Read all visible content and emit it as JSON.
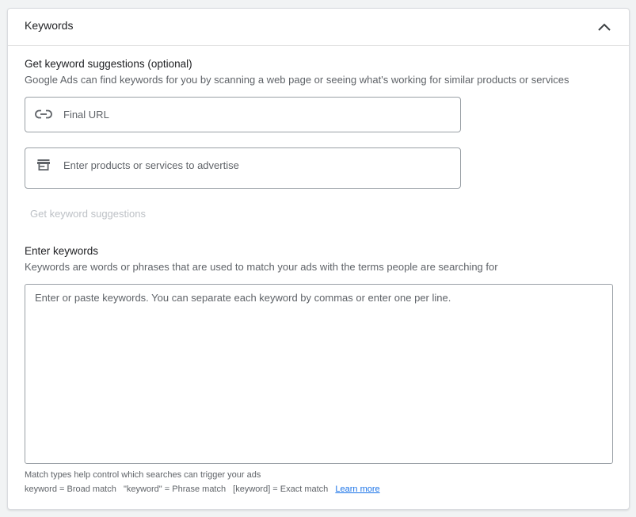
{
  "header": {
    "title": "Keywords",
    "collapse_icon": "chevron-up-icon"
  },
  "suggestions": {
    "title": "Get keyword suggestions (optional)",
    "description": "Google Ads can find keywords for you by scanning a web page or seeing what's working for similar products or services",
    "url_field": {
      "placeholder": "Final URL",
      "value": "",
      "icon": "link-icon"
    },
    "products_field": {
      "placeholder": "Enter products or services to advertise",
      "value": "",
      "icon": "store-icon"
    },
    "button_label": "Get keyword suggestions"
  },
  "keywords": {
    "title": "Enter keywords",
    "description": "Keywords are words or phrases that are used to match your ads with the terms people are searching for",
    "placeholder": "Enter or paste keywords. You can separate each keyword by commas or enter one per line.",
    "value": ""
  },
  "footer": {
    "match_types_note": "Match types help control which searches can trigger your ads",
    "broad": "keyword = Broad match",
    "phrase": "\"keyword\" = Phrase match",
    "exact": "[keyword] = Exact match",
    "learn_more": "Learn more"
  },
  "colors": {
    "accent": "#1a73e8",
    "text_primary": "#202124",
    "text_secondary": "#5f6368",
    "disabled": "#bdc1c6",
    "border": "#9aa0a6"
  }
}
